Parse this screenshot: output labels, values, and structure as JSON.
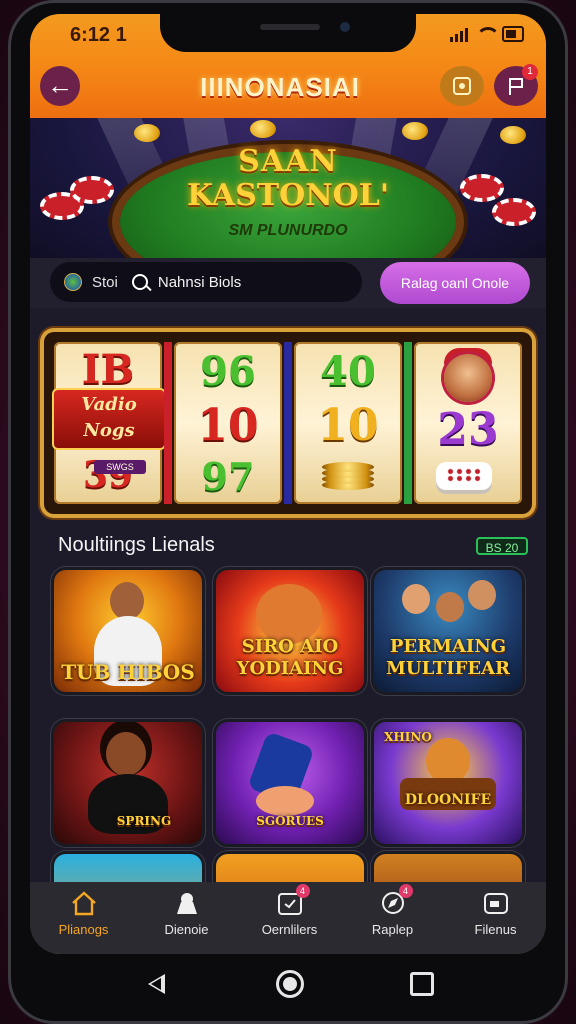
{
  "status_bar": {
    "time": "6:12 1"
  },
  "header": {
    "title": "IIINONASIAI",
    "notif_count": "1"
  },
  "hero": {
    "title_line1": "SAAN",
    "title_line2": "KASTONOL'",
    "subtitle": "SM PLUNURDO"
  },
  "search": {
    "prefix": "Stoi",
    "text": "Nahnsi Biols",
    "cta_label": "Ralag oanl Onole"
  },
  "slot": {
    "reel1": {
      "top": "IB",
      "banner_line1": "Vadio",
      "banner_line2": "Nogs",
      "bottom": "39",
      "badge": "SWGS"
    },
    "reel2": {
      "top": "96",
      "mid": "10",
      "bottom": "97"
    },
    "reel3": {
      "top": "40",
      "mid": "10"
    },
    "reel4": {
      "mid": "23"
    }
  },
  "section": {
    "title": "Noultiings Lienals",
    "badge": "BS 20"
  },
  "games": [
    {
      "caption": "TUB HIBOS"
    },
    {
      "caption_line1": "SIRO AIO",
      "caption_line2": "YODIAING"
    },
    {
      "caption_line1": "PERMAING",
      "caption_line2": "MULTIFEAR"
    },
    {
      "caption": "SPRING"
    },
    {
      "caption": "SGORUES"
    },
    {
      "caption_top": "XHINO",
      "caption": "DLOONIFE"
    }
  ],
  "tabs": [
    {
      "label": "Plianogs",
      "icon": "home-icon",
      "active": true
    },
    {
      "label": "Dienoie",
      "icon": "bag-icon"
    },
    {
      "label": "Oernlilers",
      "icon": "ticket-icon",
      "badge": "4"
    },
    {
      "label": "Raplep",
      "icon": "compass-icon",
      "badge": "4"
    },
    {
      "label": "Filenus",
      "icon": "wallet-icon"
    }
  ],
  "colors": {
    "accent": "#f58a17",
    "active_tab": "#f5a623",
    "cta": "#c45be0"
  }
}
